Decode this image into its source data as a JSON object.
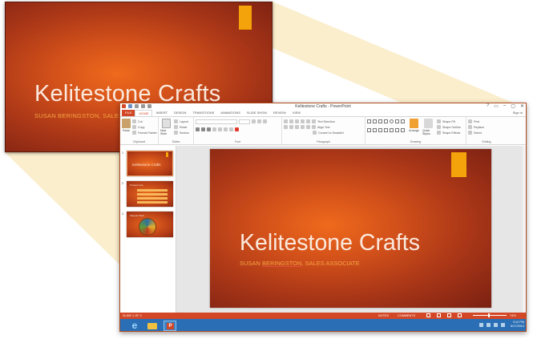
{
  "slide": {
    "title": "Kelitestone Crafts",
    "subtitle": "SUSAN BERINGSTON, SALES ASSOCIATE",
    "subtitle_pre": "SUSAN ",
    "subtitle_underlined": "BERINGSTON",
    "subtitle_post": ", SALES ASSOCIATE",
    "accent_color": "#f5a30a"
  },
  "window": {
    "title": "Kelitestone Crafts - PowerPoint",
    "controls": [
      "?",
      "▭",
      "–",
      "▢",
      "✕"
    ],
    "sign_in": "Sign in"
  },
  "tabs": [
    "FILE",
    "HOME",
    "INSERT",
    "DESIGN",
    "TRANSITIONS",
    "ANIMATIONS",
    "SLIDE SHOW",
    "REVIEW",
    "VIEW"
  ],
  "active_tab": "HOME",
  "ribbon": {
    "clipboard": {
      "paste": "Paste",
      "cut": "Cut",
      "copy": "Copy",
      "format_painter": "Format Painter",
      "label": "Clipboard"
    },
    "slides": {
      "new_slide": "New Slide",
      "layout": "Layout",
      "reset": "Reset",
      "section": "Section",
      "label": "Slides"
    },
    "font": {
      "label": "Font"
    },
    "paragraph": {
      "text_direction": "Text Direction",
      "align_text": "Align Text",
      "smartart": "Convert to SmartArt",
      "label": "Paragraph"
    },
    "drawing": {
      "arrange": "Arrange",
      "quick_styles": "Quick Styles",
      "shape_fill": "Shape Fill",
      "shape_outline": "Shape Outline",
      "shape_effects": "Shape Effects",
      "label": "Drawing"
    },
    "editing": {
      "find": "Find",
      "replace": "Replace",
      "select": "Select",
      "label": "Editing"
    }
  },
  "thumbnails": [
    {
      "num": "1",
      "title": "Kelitestone Crafts"
    },
    {
      "num": "2",
      "title": "Product Line"
    },
    {
      "num": "3",
      "title": "Sample Work"
    }
  ],
  "status": {
    "slide_info": "SLIDE 1 OF 3",
    "notes": "NOTES",
    "comments": "COMMENTS",
    "zoom": "74%"
  },
  "taskbar": {
    "time": "3:12 PM",
    "date": "6/17/2014"
  }
}
